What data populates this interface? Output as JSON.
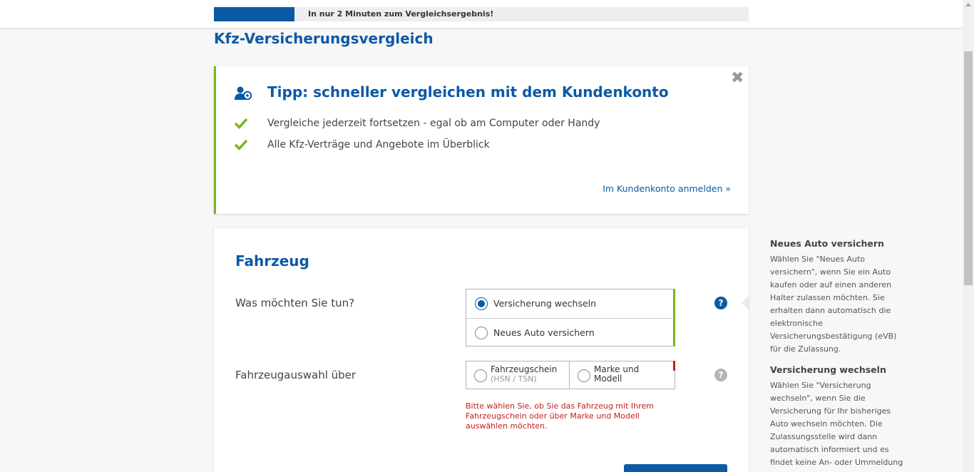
{
  "header": {
    "progress_text": "In nur 2 Minuten zum Vergleichsergebnis!",
    "progress_fraction": 0.15
  },
  "page": {
    "title": "Kfz-Versicherungsvergleich"
  },
  "tip": {
    "close_symbol": "✖",
    "title": "Tipp: schneller vergleichen mit dem Kundenkonto",
    "items": [
      {
        "text": "Vergleiche jederzeit fortsetzen - egal ob am Computer oder Handy"
      },
      {
        "text": "Alle Kfz-Verträge und Angebote im Überblick"
      }
    ],
    "login_link": "Im Kundenkonto anmelden »"
  },
  "form": {
    "section_title": "Fahrzeug",
    "question1": {
      "label": "Was möchten Sie tun?",
      "options": [
        {
          "label": "Versicherung wechseln",
          "checked": true
        },
        {
          "label": "Neues Auto versichern",
          "checked": false
        }
      ],
      "help": "?"
    },
    "question2": {
      "label": "Fahrzeugauswahl über",
      "options": [
        {
          "line1": "Fahrzeugschein",
          "line2": "(HSN / TSN)"
        },
        {
          "line1": "Marke und",
          "line2": "Modell"
        }
      ],
      "help": "?",
      "error": "Bitte wählen Sie, ob Sie das Fahrzeug mit Ihrem Fahrzeugschein oder über Marke und Modell auswählen möchten."
    }
  },
  "sidebar": {
    "blocks": [
      {
        "title": "Neues Auto versichern",
        "text": "Wählen Sie \"Neues Auto versichern\", wenn Sie ein Auto kaufen oder auf einen anderen Halter zulassen möchten. Sie erhalten dann automatisch die elektronische Versicherungsbestätigung (eVB) für die Zulassung."
      },
      {
        "title": "Versicherung wechseln",
        "text": "Wählen Sie \"Versicherung wechseln\", wenn Sie die Versicherung für Ihr bisheriges Auto wechseln möchten. Die Zulassungsstelle wird dann automatisch informiert und es findet keine An- oder Ummeldung"
      }
    ]
  },
  "colors": {
    "brand_blue": "#0c59a6",
    "accent_green": "#7ab51d",
    "error_red": "#c41e1e"
  }
}
